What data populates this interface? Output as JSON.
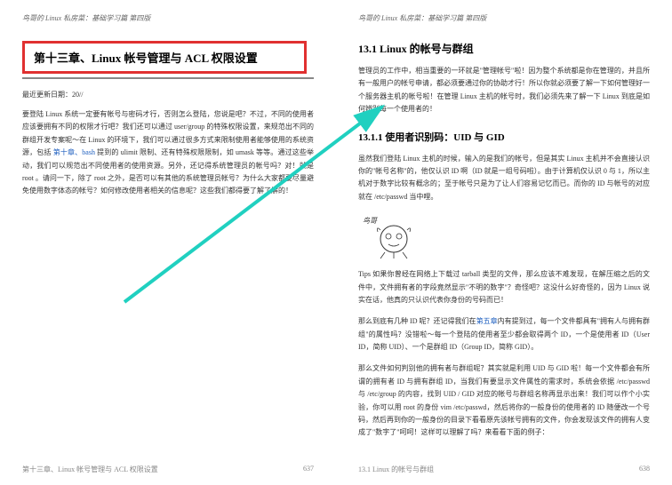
{
  "header": {
    "text_left": "鸟哥的 Linux 私房菜：基础学习篇 第四版",
    "text_right": "鸟哥的 Linux 私房菜：基础学习篇 第四版"
  },
  "left_page": {
    "chapter_title": "第十三章、Linux 帐号管理与 ACL 权限设置",
    "update_date": "最近更新日期：20//",
    "body": "要登陆 Linux 系统一定要有帐号与密码才行，否则怎么登陆，您说是吧？不过，不同的使用者应该要拥有不同的权限才行吧？我们还可以通过 user/group 的特殊权限设置，来规范出不同的群组开发专案呢～在 Linux 的环境下，我们可以通过很多方式来限制使用者能够使用的系统资源，包括 第十章 bash 提到的 ulimit 限制、还有特殊权限限制，如 umask 等等。通过这些举动，我们可以规范出不同使用者的使用资源。另外，还记得系统管理员的帐号吗？对！就是 root 。请问一下，除了 root 之外，是否可以有其他的系统管理员帐号？为什么大家都要尽量避免使用数字体态的帐号？如何修改使用者相关的信息呢？这些我们都得要了解了解的！",
    "link1": "第十章、bash",
    "footer_text": "第十三章、Linux 帐号管理与 ACL 权限设置",
    "page_num": "637"
  },
  "right_page": {
    "section_title": "13.1 Linux 的帐号与群组",
    "section_body": "管理员的工作中，相当重要的一环就是\"管理帐号\"啦！因为整个系统都是你在管理的，并且所有一般用户的帐号申请，都必须要通过你的协助才行！所以你就必须要了解一下如何管理好一个服务器主机的帐号啦！在管理 Linux 主机的帐号时，我们必须先来了解一下 Linux 到底是如何辨别每一个使用者的！",
    "subsection_title": "13.1.1 使用者识别码：UID 与 GID",
    "sub_body1": "虽然我们登陆 Linux 主机的时候，输入的是我们的帐号，但是其实 Linux 主机并不会直接认识你的\"帐号名称\"的，他仅认识 ID 啊（ID 就是一组号码啦）。由于计算机仅认识 0 与 1，所以主机对于数字比较有概念的；至于帐号只是为了让人们容易记忆而已。而你的 ID 与帐号的对应就在 /etc/passwd 当中哩。",
    "tips_text": "Tips 如果你曾经在网络上下载过 tarball 类型的文件，那么应该不难发现，在解压缩之后的文件中，文件拥有者的字段竟然显示\"不明的数字\"？奇怪吧？这没什么好奇怪的，因为 Linux 说实在话，他真的只认识代表你身份的号码而已！",
    "body2": "那么到底有几种 ID 呢？还记得我们在第五章内有提到过，每一个文件都具有\"拥有人与拥有群组\"的属性吗？没错啦～每一个登陆的使用者至少都会取得两个 ID，一个是使用者 ID（User ID，简称 UID）、一个是群组 ID（Group ID，简称 GID）。",
    "body3": "那么文件如何判别他的拥有者与群组呢？其实就是利用 UID 与 GID 啦！每一个文件都会有所谓的拥有者 ID 与拥有群组 ID，当我们有要显示文件属性的需求时，系统会依据 /etc/passwd 与 /etc/group 的内容，找到 UID / GID 对应的帐号与群组名称再显示出来！我们可以作个小实验，你可以用 root 的身份 vim /etc/passwd，然后将你的一般身份的使用者的 ID 随便改一个号码，然后再到你的一般身份的目录下看看原先该帐号拥有的文件，你会发现该文件的拥有人变成了\"数字了\"呵呵！这样可以理解了吗？来看看下面的例子：",
    "link2": "第五章",
    "footer_text": "13.1 Linux 的帐号与群组",
    "page_num": "638"
  },
  "icons": {
    "illustration": "vbird-character"
  }
}
